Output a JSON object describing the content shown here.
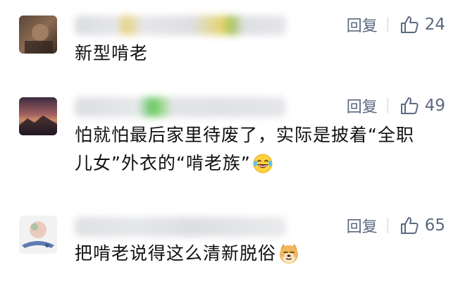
{
  "comments": [
    {
      "reply_label": "回复",
      "likes": "24",
      "text": "新型啃老"
    },
    {
      "reply_label": "回复",
      "likes": "49",
      "text_line1": "怕就怕最后家里待废了，实际是披着“全职",
      "text_line2": "儿女”外衣的“啃老族”"
    },
    {
      "reply_label": "回复",
      "likes": "65",
      "text": "把啃老说得这么清新脱俗"
    }
  ],
  "icons": {
    "like": "thumbs-up-icon",
    "emoji_2": "laughing-tears-emoji",
    "emoji_3": "doge-emoji"
  },
  "colors": {
    "action_text": "#5b6a80",
    "body_text": "#111111"
  }
}
